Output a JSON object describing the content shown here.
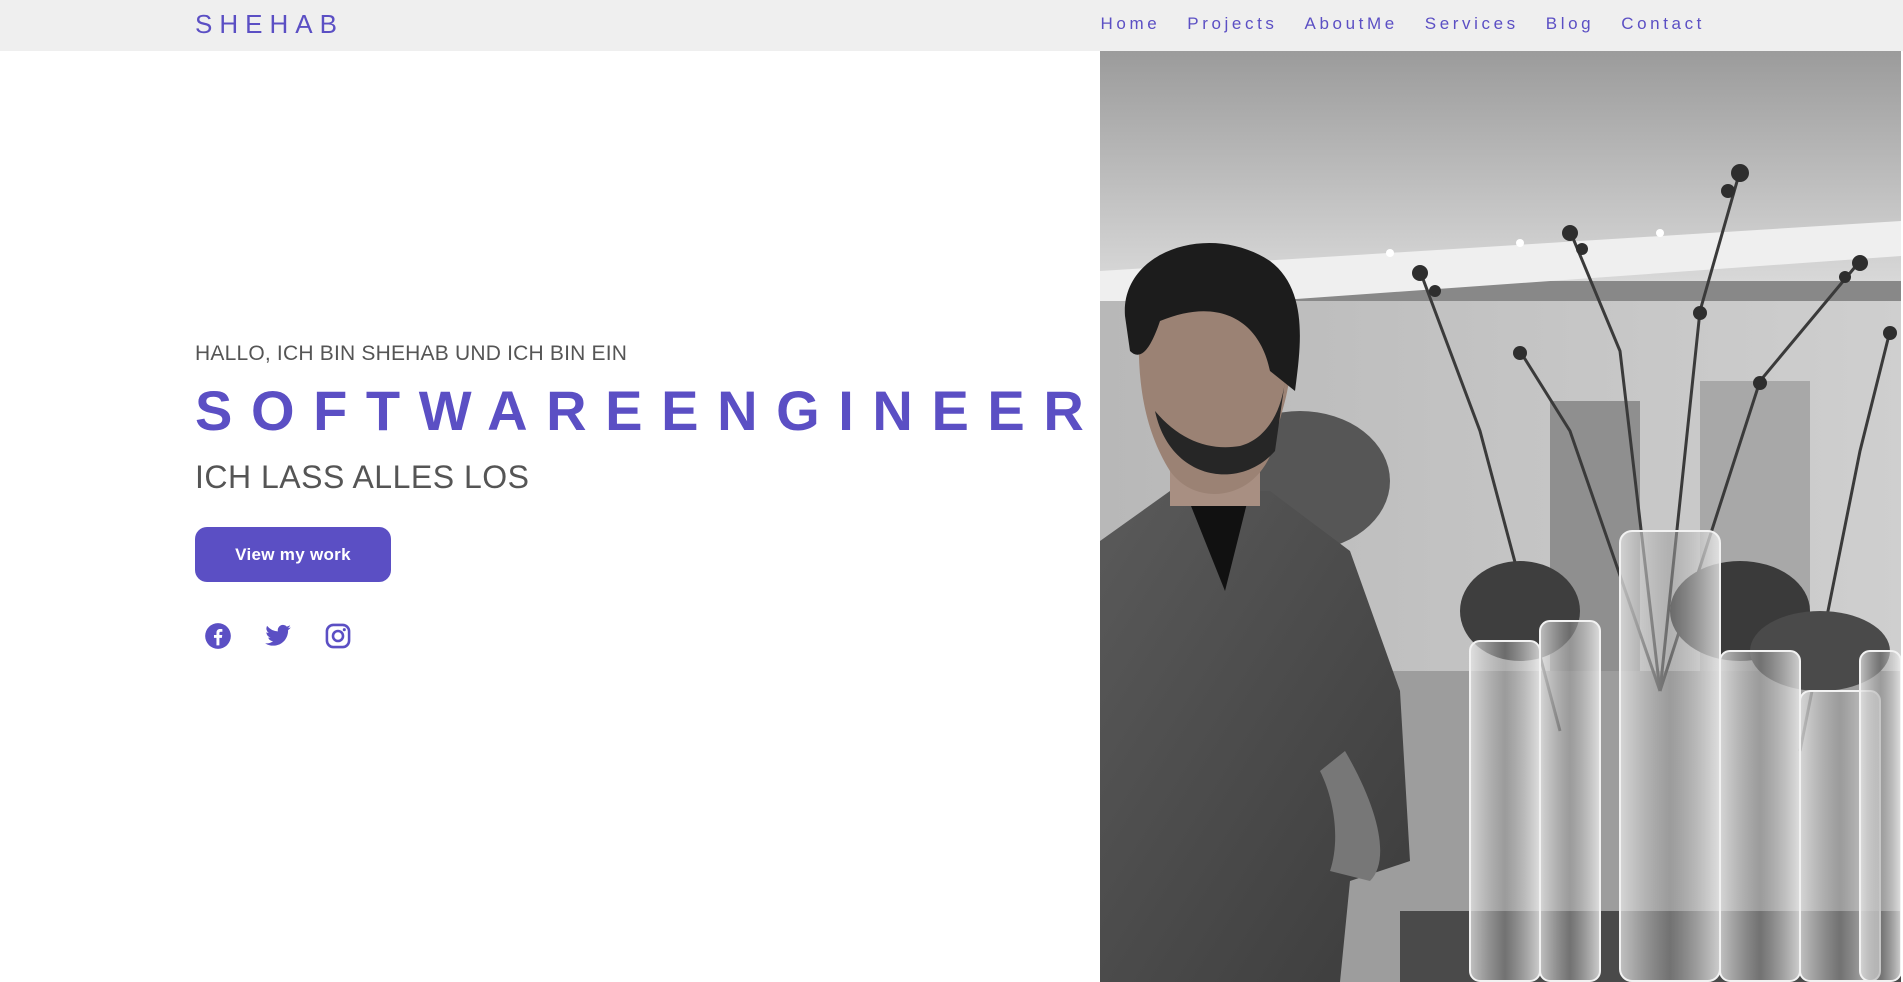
{
  "brand": "SHEHAB",
  "nav": {
    "items": [
      "Home",
      "Projects",
      "AboutMe",
      "Services",
      "Blog",
      "Contact"
    ]
  },
  "hero": {
    "greeting": "HALLO, ICH BIN SHEHAB UND ICH BIN EIN",
    "role": "SOFTWAREENGINEER",
    "tagline": "ICH LASS ALLES LOS",
    "cta_label": "View my work"
  },
  "socials": [
    "facebook-icon",
    "twitter-icon",
    "instagram-icon"
  ],
  "colors": {
    "accent": "#5b4fc4",
    "nav_bg": "#efefef",
    "text_muted": "#555555"
  }
}
